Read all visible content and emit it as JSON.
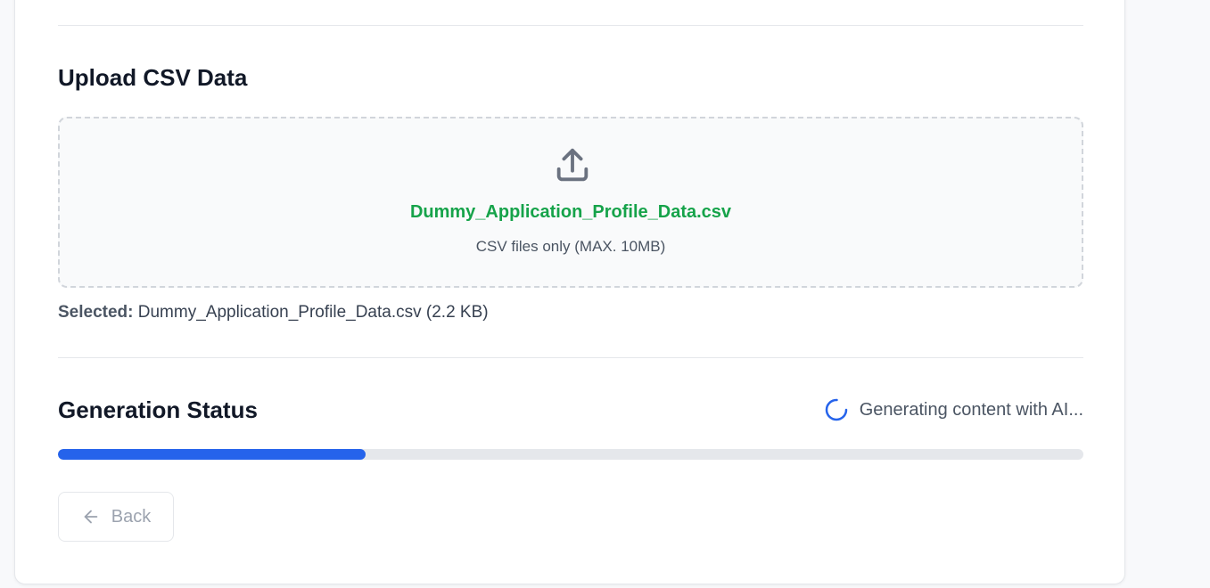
{
  "upload_section": {
    "title": "Upload CSV Data",
    "icon": "upload-icon",
    "dropzone_file_name": "Dummy_Application_Profile_Data.csv",
    "dropzone_hint": "CSV files only (MAX. 10MB)",
    "selected_label": "Selected:",
    "selected_value": "Dummy_Application_Profile_Data.csv (2.2 KB)"
  },
  "generation_status": {
    "title": "Generation Status",
    "status_text": "Generating content with AI...",
    "progress_fraction": 0.3,
    "colors": {
      "progress_fill": "#2563eb",
      "progress_track": "#e5e7eb",
      "file_name": "#16a34a",
      "spinner": "#2563eb"
    }
  },
  "actions": {
    "back_label": "Back",
    "back_icon": "arrow-left-icon"
  }
}
